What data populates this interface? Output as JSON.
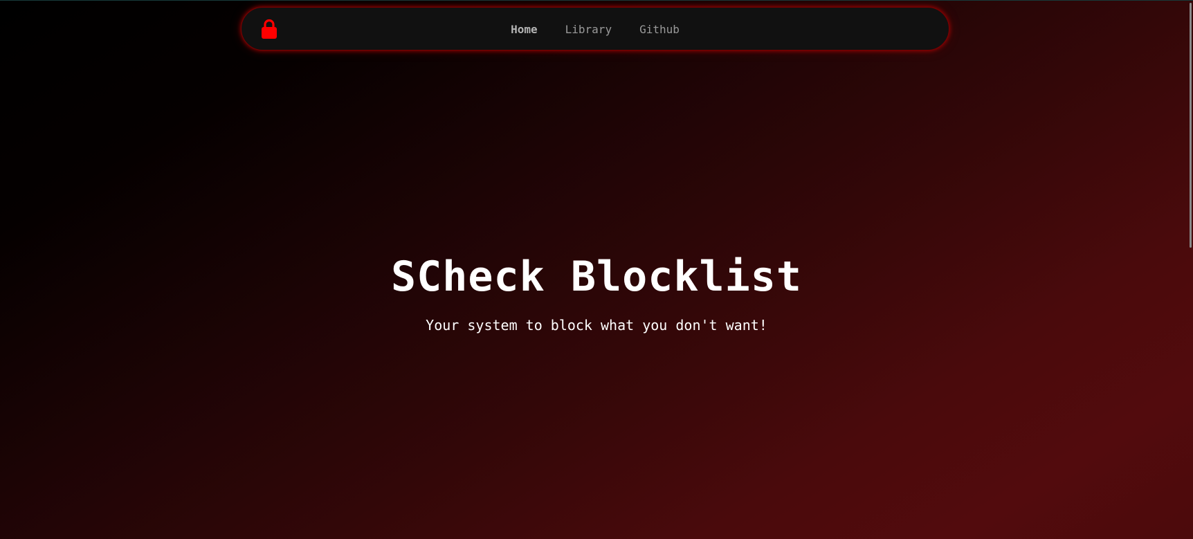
{
  "nav": {
    "logo_icon": "lock-icon",
    "links": [
      {
        "label": "Home",
        "active": true
      },
      {
        "label": "Library",
        "active": false
      },
      {
        "label": "Github",
        "active": false
      }
    ]
  },
  "hero": {
    "title": "SCheck Blocklist",
    "subtitle": "Your system to block what you don't want!"
  },
  "colors": {
    "accent": "#ff0000",
    "navbar_bg": "#111111",
    "text": "#ffffff",
    "nav_text": "#9a9a9a"
  }
}
